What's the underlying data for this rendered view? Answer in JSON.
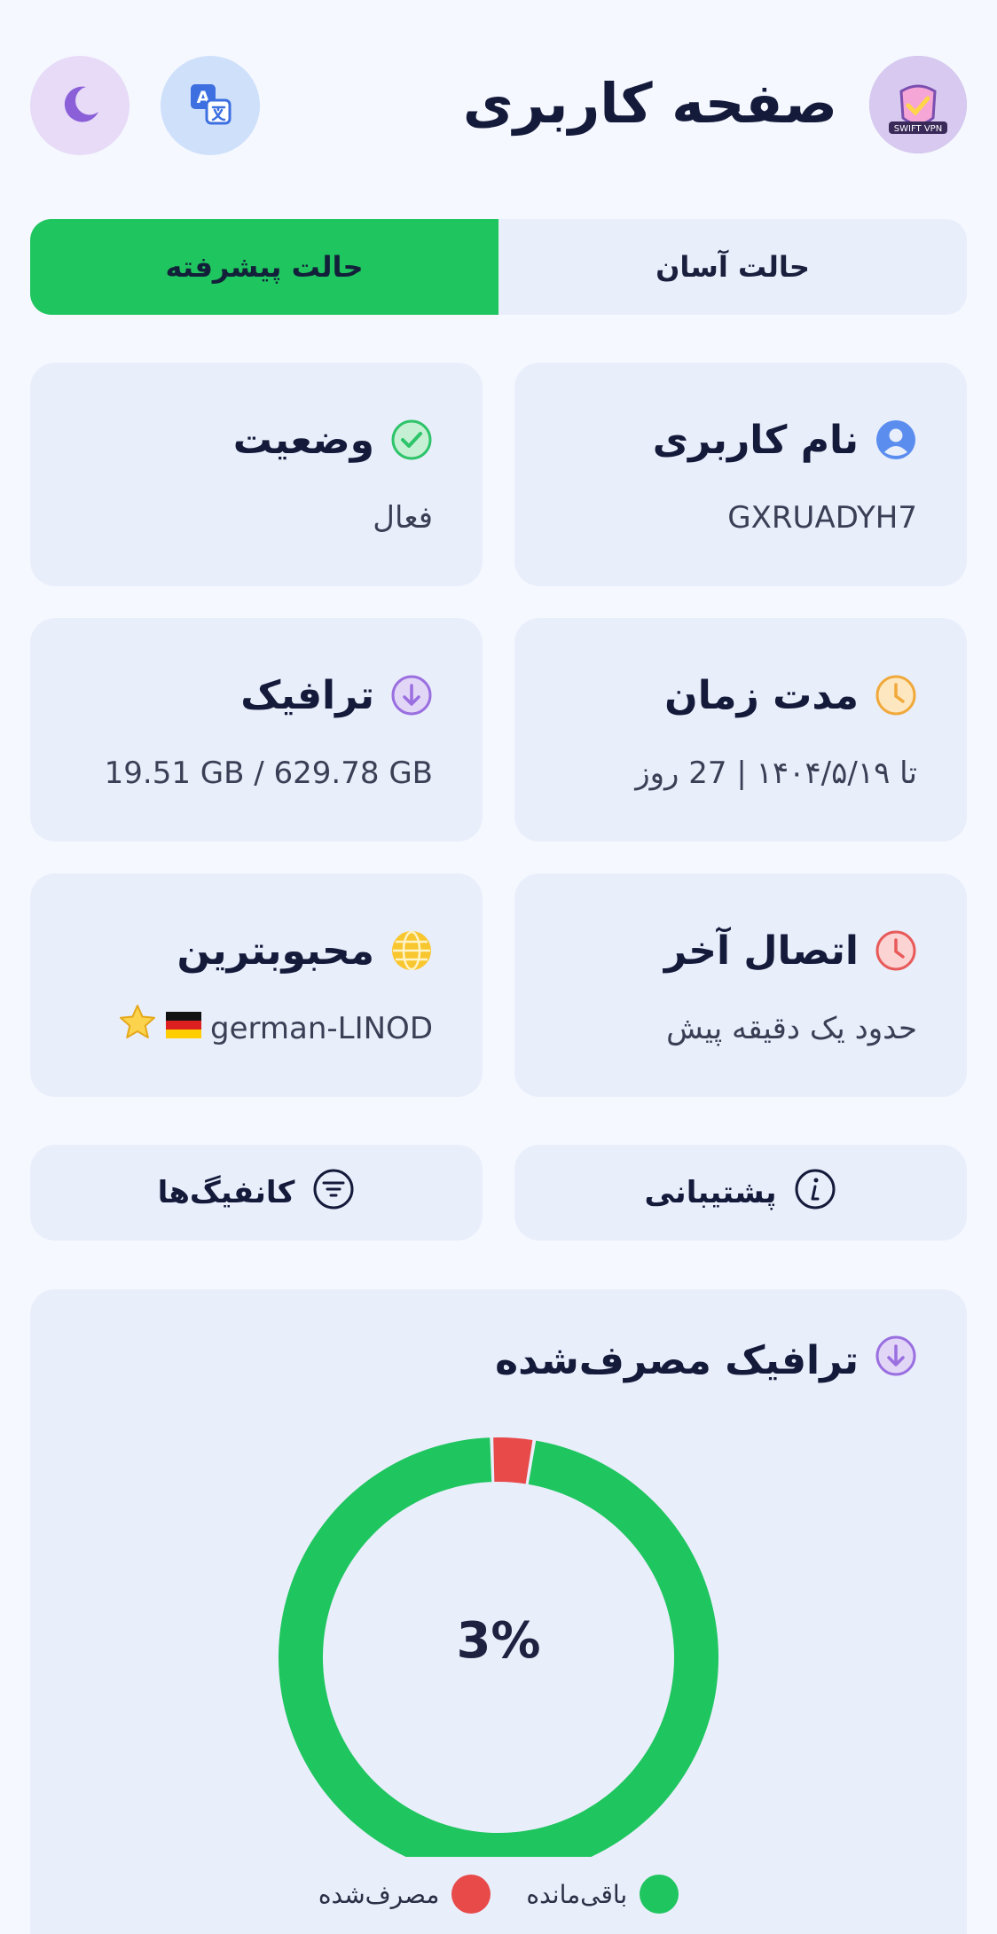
{
  "header": {
    "title": "صفحه کاربری",
    "logo_text": "SWIFT VPN",
    "translate_icon": "translate-icon",
    "theme_icon": "moon-icon"
  },
  "modes": {
    "easy": "حالت آسان",
    "advanced": "حالت پیشرفته",
    "active": "advanced"
  },
  "cards": {
    "username": {
      "title": "نام کاربری",
      "value": "GXRUADYH7",
      "icon": "user-icon"
    },
    "status": {
      "title": "وضعیت",
      "value": "فعال",
      "icon": "check-circle-icon"
    },
    "duration": {
      "title": "مدت زمان",
      "value": "تا ۱۴۰۴/۵/۱۹ | 27 روز",
      "icon": "clock-icon"
    },
    "traffic": {
      "title": "ترافیک",
      "value": "19.51 GB / 629.78 GB",
      "icon": "download-icon"
    },
    "last_connection": {
      "title": "اتصال آخر",
      "value": "حدود یک دقیقه پیش",
      "icon": "clock-icon"
    },
    "favorite": {
      "title": "محبوبترین",
      "value": "german-LINOD",
      "flag": "🇩🇪",
      "star": "⭐",
      "icon": "globe-icon"
    }
  },
  "actions": {
    "support": "پشتیبانی",
    "configs": "کانفیگ‌ها"
  },
  "colors": {
    "accent": "#1fc55e",
    "used": "#e84a4a",
    "remaining": "#1fc55e",
    "card_bg": "#e9eefb"
  },
  "chart_data": {
    "type": "pie",
    "title": "ترافیک مصرف‌شده",
    "center_label": "3%",
    "slices": [
      {
        "name": "مصرف‌شده",
        "value": 3.1,
        "color": "#e84a4a"
      },
      {
        "name": "باقی‌مانده",
        "value": 96.9,
        "color": "#1fc55e"
      }
    ],
    "legend": [
      "مصرف‌شده",
      "باقی‌مانده"
    ],
    "legend_placement": "bottom"
  }
}
